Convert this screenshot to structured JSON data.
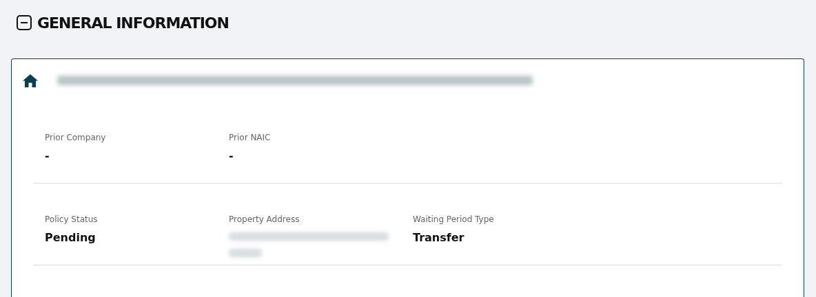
{
  "section": {
    "title": "GENERAL INFORMATION",
    "expanded": true
  },
  "card": {
    "title_redacted": true,
    "rows": [
      {
        "fields": [
          {
            "label": "Prior Company",
            "kind": "text",
            "value": "-"
          },
          {
            "label": "Prior NAIC",
            "kind": "text",
            "value": "-"
          }
        ]
      },
      {
        "fields": [
          {
            "label": "Policy Status",
            "kind": "text",
            "value": "Pending"
          },
          {
            "label": "Property Address",
            "kind": "redacted"
          },
          {
            "label": "Waiting Period Type",
            "kind": "text",
            "value": "Transfer"
          }
        ]
      }
    ]
  }
}
